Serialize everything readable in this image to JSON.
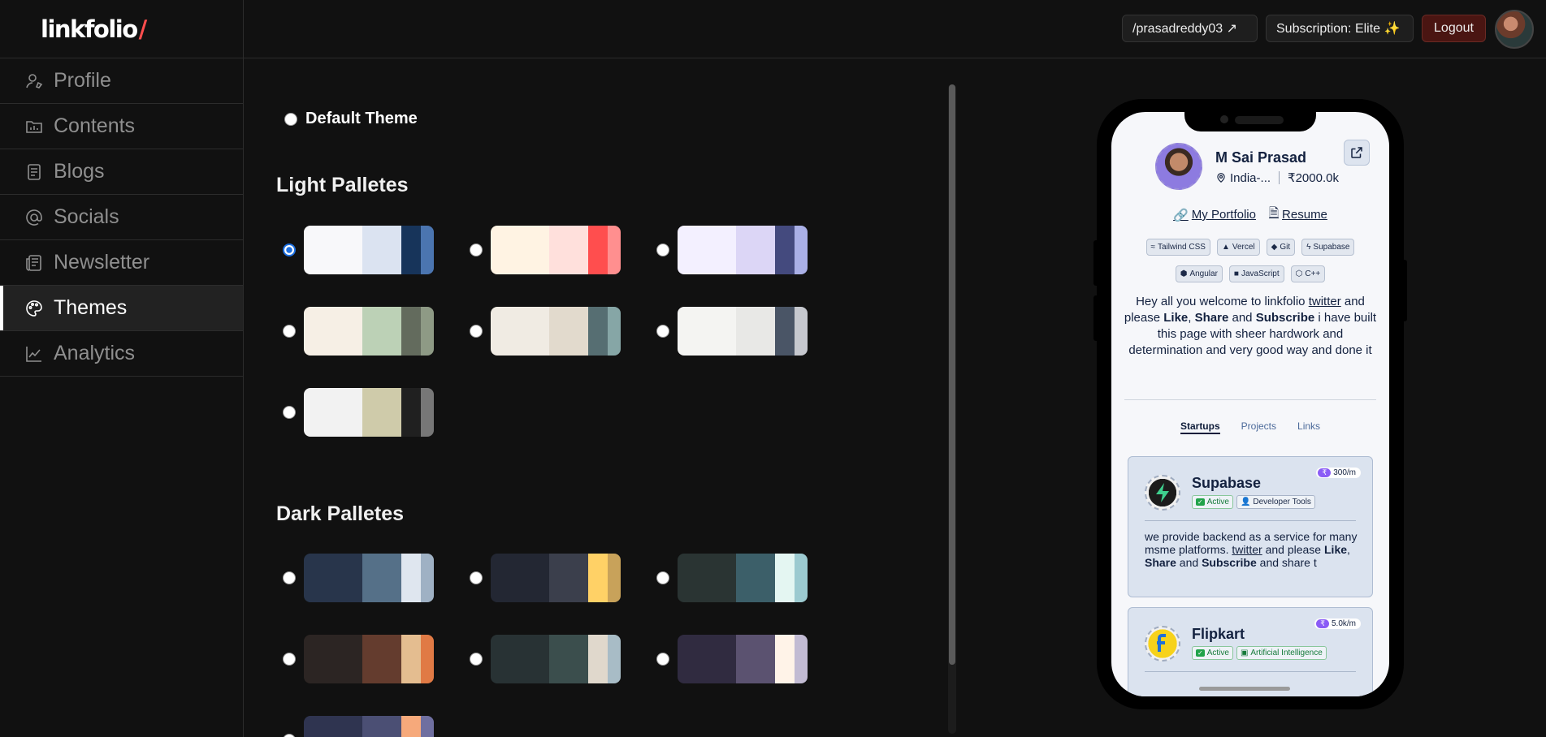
{
  "app": {
    "logo_text": "linkfolio",
    "logo_slash": "/"
  },
  "sidebar": {
    "items": [
      {
        "label": "Profile",
        "icon": "user-icon",
        "active": false
      },
      {
        "label": "Contents",
        "icon": "folder-icon",
        "active": false
      },
      {
        "label": "Blogs",
        "icon": "document-icon",
        "active": false
      },
      {
        "label": "Socials",
        "icon": "at-icon",
        "active": false
      },
      {
        "label": "Newsletter",
        "icon": "newspaper-icon",
        "active": false
      },
      {
        "label": "Themes",
        "icon": "palette-icon",
        "active": true
      },
      {
        "label": "Analytics",
        "icon": "chart-line-icon",
        "active": false
      }
    ]
  },
  "topbar": {
    "profile_link": "/prasadreddy03 ↗",
    "subscription": "Subscription: Elite ✨",
    "logout": "Logout"
  },
  "themes": {
    "default_label": "Default Theme",
    "light_title": "Light Palletes",
    "dark_title": "Dark Palletes",
    "selected": "light-1",
    "light": [
      [
        "#f8f8fa",
        "#dbe3f1",
        "#17345a",
        "#4b75b0"
      ],
      [
        "#fff3e3",
        "#ffe0dc",
        "#ff4e4e",
        "#ff8f8f"
      ],
      [
        "#f3f0ff",
        "#dcd6f6",
        "#444a7e",
        "#aab0e6"
      ],
      [
        "#f6efe5",
        "#bcd1b6",
        "#636b5d",
        "#8e9a85"
      ],
      [
        "#f0ebe3",
        "#e2dacd",
        "#566e72",
        "#86a6a6"
      ],
      [
        "#f4f4f2",
        "#e8e8e6",
        "#4a5566",
        "#c6c8ce"
      ],
      [
        "#f2f2f2",
        "#cfcbaa",
        "#202020",
        "#777777"
      ]
    ],
    "dark": [
      [
        "#28354b",
        "#557088",
        "#dfe6ef",
        "#9fb1c4"
      ],
      [
        "#232733",
        "#3b3f4c",
        "#ffd166",
        "#c8a25a"
      ],
      [
        "#2a3433",
        "#3c5f69",
        "#e4f6f2",
        "#9ccad0"
      ],
      [
        "#2c2523",
        "#643c2e",
        "#e4bd90",
        "#e07a45"
      ],
      [
        "#283234",
        "#3b4e4d",
        "#e0d8cc",
        "#a8bcc6"
      ],
      [
        "#302b40",
        "#5b5270",
        "#fff3e8",
        "#c2bbd3"
      ],
      [
        "#2f3450",
        "#4b4f74",
        "#f6a97b",
        "#6f6fa0"
      ]
    ]
  },
  "preview": {
    "name": "M Sai Prasad",
    "location": "India-...",
    "rate": "₹2000.0k",
    "links": [
      "My Portfolio",
      "Resume"
    ],
    "skills_row1": [
      "Tailwind CSS",
      "Vercel",
      "Git",
      "Supabase"
    ],
    "skills_row2": [
      "Angular",
      "JavaScript",
      "C++"
    ],
    "bio_1": "Hey all you welcome to linkfolio ",
    "bio_link": "twitter",
    "bio_2": " and please ",
    "bio_like": "Like",
    "bio_comma": ", ",
    "bio_share": "Share",
    "bio_and": " and ",
    "bio_sub": "Subscribe",
    "bio_3": " i have built this page with sheer hardwork and determination and very good way and done it",
    "tabs": [
      "Startups",
      "Projects",
      "Links"
    ],
    "cards": [
      {
        "title": "Supabase",
        "price": "300/m",
        "status": "Active",
        "category": "Developer Tools",
        "desc_1": "we provide backend as a service for many msme platforms. ",
        "desc_link": "twitter",
        "desc_2": " and please ",
        "desc_like": "Like",
        "desc_comma": ", ",
        "desc_share": "Share",
        "desc_and": " and ",
        "desc_sub": "Subscribe",
        "desc_3": " and share t"
      },
      {
        "title": "Flipkart",
        "price": "5.0k/m",
        "status": "Active",
        "category": "Artificial Intelligence"
      }
    ],
    "price_symbol": "₹"
  },
  "colors": {
    "background": "#111111",
    "accent_red": "#ff4d4d",
    "radio_selected": "#1d6fe0",
    "logout_bg": "#4a1512"
  }
}
